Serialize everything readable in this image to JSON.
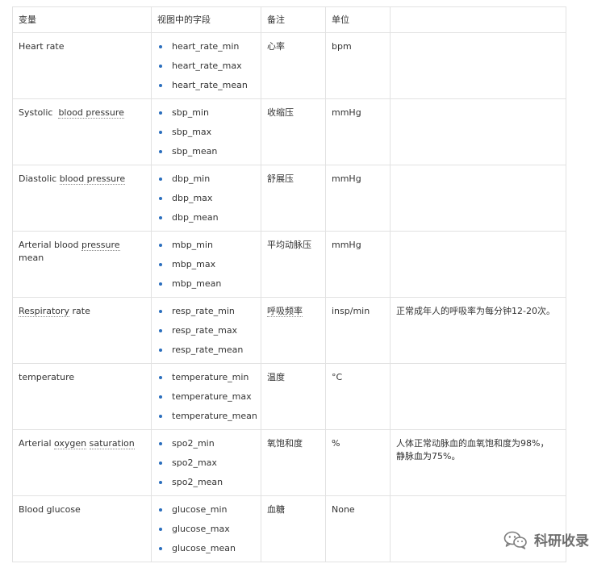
{
  "headers": [
    "变量",
    "视图中的字段",
    "备注",
    "单位",
    ""
  ],
  "rows": [
    {
      "variable": "Heart rate",
      "fields": [
        "heart_rate_min",
        "heart_rate_max",
        "heart_rate_mean"
      ],
      "note": "心率",
      "unit": "bpm",
      "extra": ""
    },
    {
      "variable_parts": [
        "Systolic",
        "blood pressure"
      ],
      "fields": [
        "sbp_min",
        "sbp_max",
        "sbp_mean"
      ],
      "note": "收缩压",
      "unit": "mmHg",
      "extra": ""
    },
    {
      "variable_parts": [
        "Diastolic",
        "blood pressure"
      ],
      "fields": [
        "dbp_min",
        "dbp_max",
        "dbp_mean"
      ],
      "note": "舒展压",
      "unit": "mmHg",
      "extra": ""
    },
    {
      "variable_parts": [
        "Arterial blood",
        "pressure",
        "mean"
      ],
      "fields": [
        "mbp_min",
        "mbp_max",
        "mbp_mean"
      ],
      "note": "平均动脉压",
      "unit": "mmHg",
      "extra": ""
    },
    {
      "variable_parts": [
        "Respiratory",
        "rate"
      ],
      "fields": [
        "resp_rate_min",
        "resp_rate_max",
        "resp_rate_mean"
      ],
      "note": "呼吸频率",
      "unit": "insp/min",
      "extra": "正常成年人的呼吸率为每分钟12-20次。"
    },
    {
      "variable": "temperature",
      "fields": [
        "temperature_min",
        "temperature_max",
        "temperature_mean"
      ],
      "note": "温度",
      "unit": "°C",
      "extra": ""
    },
    {
      "variable_parts": [
        "Arterial",
        "oxygen",
        "saturation"
      ],
      "fields": [
        "spo2_min",
        "spo2_max",
        "spo2_mean"
      ],
      "note": "氧饱和度",
      "unit": "%",
      "extra_lines": [
        "人体正常动脉血的血氧饱和度为98%，",
        "静脉血为75%。"
      ]
    },
    {
      "variable": "Blood glucose",
      "fields": [
        "glucose_min",
        "glucose_max",
        "glucose_mean"
      ],
      "note": "血糖",
      "unit": "None",
      "extra": ""
    }
  ],
  "watermark": {
    "icon": "wechat-icon",
    "text": "科研收录"
  }
}
